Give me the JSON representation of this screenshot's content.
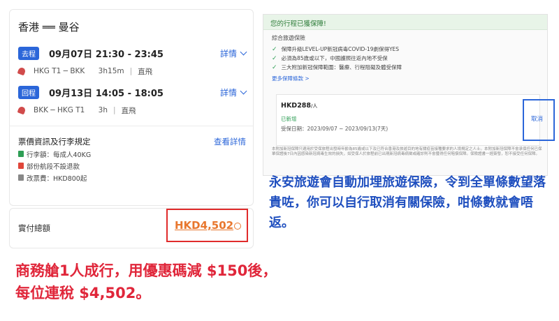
{
  "flight": {
    "route_title": "香港 ══ 曼谷",
    "outbound": {
      "tag": "去程",
      "date_time": "09月07日  21:30 - 23:45",
      "details_label": "詳情",
      "route": "HKG T1 ─ BKK",
      "duration": "3h15m",
      "type": "直飛"
    },
    "return": {
      "tag": "回程",
      "date_time": "09月13日  14:05 - 18:05",
      "details_label": "詳情",
      "route": "BKK ─ HKG T1",
      "duration": "3h",
      "type": "直飛"
    },
    "fare": {
      "title": "票價資訊及行李規定",
      "link": "查看詳情",
      "items": [
        "行李額：每成人40KG",
        "部份航段不設退款",
        "改票費：HKD800起"
      ]
    },
    "total": {
      "label": "實付總額",
      "amount": "HKD4,502"
    }
  },
  "insurance": {
    "header": "您的行程已獲保障!",
    "subtitle": "綜合旅遊保險",
    "points": [
      "保障升級LEVEL-UP新冠病毒COVID-19劇保得YES",
      "必須為85歲或以下，中國護照往返內地不受保",
      "三大附加新冠保障範圍：醫療、行程阻礙及體受保障"
    ],
    "more": "更多保障條款 >",
    "price": "HKD288",
    "price_unit": "/人",
    "status": "已新增",
    "dates": "受保日期：2023/09/07 ~ 2023/09/13(7天)",
    "cancel": "取消",
    "fine_print": "本附加新冠保障只適用於受保旅程出發時年齡為85歲或以下及已符合香港及旅遊目的地有關疫苗接種要求的人境規定之人士。本附加新冠保障不會承保任何已保單保證後7日內因感染新冠病毒生效的損失，如受保人於旅程前已出現新冠病毒病徵或確診則不會獲得任何賠償保障。保險證書一經簽發，恕不接受任何保障。"
  },
  "annotations": {
    "blue": "永安旅遊會自動加埋旅遊保險，令到全單條數望落貴咗，你可以自行取消有關保險，咁條數就會唔返。",
    "red_line1": "商務艙1人成行，用優惠碼減 $150後，",
    "red_line2": "每位連稅 $4,502。"
  }
}
